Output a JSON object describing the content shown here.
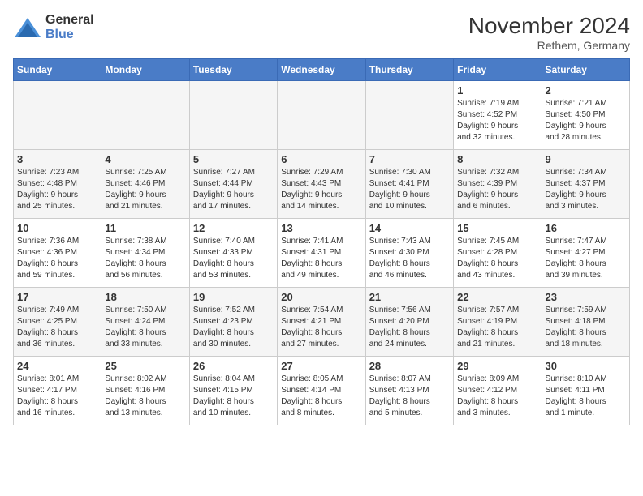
{
  "logo": {
    "general": "General",
    "blue": "Blue"
  },
  "title": {
    "month": "November 2024",
    "location": "Rethem, Germany"
  },
  "weekdays": [
    "Sunday",
    "Monday",
    "Tuesday",
    "Wednesday",
    "Thursday",
    "Friday",
    "Saturday"
  ],
  "weeks": [
    [
      {
        "day": "",
        "info": ""
      },
      {
        "day": "",
        "info": ""
      },
      {
        "day": "",
        "info": ""
      },
      {
        "day": "",
        "info": ""
      },
      {
        "day": "",
        "info": ""
      },
      {
        "day": "1",
        "info": "Sunrise: 7:19 AM\nSunset: 4:52 PM\nDaylight: 9 hours\nand 32 minutes."
      },
      {
        "day": "2",
        "info": "Sunrise: 7:21 AM\nSunset: 4:50 PM\nDaylight: 9 hours\nand 28 minutes."
      }
    ],
    [
      {
        "day": "3",
        "info": "Sunrise: 7:23 AM\nSunset: 4:48 PM\nDaylight: 9 hours\nand 25 minutes."
      },
      {
        "day": "4",
        "info": "Sunrise: 7:25 AM\nSunset: 4:46 PM\nDaylight: 9 hours\nand 21 minutes."
      },
      {
        "day": "5",
        "info": "Sunrise: 7:27 AM\nSunset: 4:44 PM\nDaylight: 9 hours\nand 17 minutes."
      },
      {
        "day": "6",
        "info": "Sunrise: 7:29 AM\nSunset: 4:43 PM\nDaylight: 9 hours\nand 14 minutes."
      },
      {
        "day": "7",
        "info": "Sunrise: 7:30 AM\nSunset: 4:41 PM\nDaylight: 9 hours\nand 10 minutes."
      },
      {
        "day": "8",
        "info": "Sunrise: 7:32 AM\nSunset: 4:39 PM\nDaylight: 9 hours\nand 6 minutes."
      },
      {
        "day": "9",
        "info": "Sunrise: 7:34 AM\nSunset: 4:37 PM\nDaylight: 9 hours\nand 3 minutes."
      }
    ],
    [
      {
        "day": "10",
        "info": "Sunrise: 7:36 AM\nSunset: 4:36 PM\nDaylight: 8 hours\nand 59 minutes."
      },
      {
        "day": "11",
        "info": "Sunrise: 7:38 AM\nSunset: 4:34 PM\nDaylight: 8 hours\nand 56 minutes."
      },
      {
        "day": "12",
        "info": "Sunrise: 7:40 AM\nSunset: 4:33 PM\nDaylight: 8 hours\nand 53 minutes."
      },
      {
        "day": "13",
        "info": "Sunrise: 7:41 AM\nSunset: 4:31 PM\nDaylight: 8 hours\nand 49 minutes."
      },
      {
        "day": "14",
        "info": "Sunrise: 7:43 AM\nSunset: 4:30 PM\nDaylight: 8 hours\nand 46 minutes."
      },
      {
        "day": "15",
        "info": "Sunrise: 7:45 AM\nSunset: 4:28 PM\nDaylight: 8 hours\nand 43 minutes."
      },
      {
        "day": "16",
        "info": "Sunrise: 7:47 AM\nSunset: 4:27 PM\nDaylight: 8 hours\nand 39 minutes."
      }
    ],
    [
      {
        "day": "17",
        "info": "Sunrise: 7:49 AM\nSunset: 4:25 PM\nDaylight: 8 hours\nand 36 minutes."
      },
      {
        "day": "18",
        "info": "Sunrise: 7:50 AM\nSunset: 4:24 PM\nDaylight: 8 hours\nand 33 minutes."
      },
      {
        "day": "19",
        "info": "Sunrise: 7:52 AM\nSunset: 4:23 PM\nDaylight: 8 hours\nand 30 minutes."
      },
      {
        "day": "20",
        "info": "Sunrise: 7:54 AM\nSunset: 4:21 PM\nDaylight: 8 hours\nand 27 minutes."
      },
      {
        "day": "21",
        "info": "Sunrise: 7:56 AM\nSunset: 4:20 PM\nDaylight: 8 hours\nand 24 minutes."
      },
      {
        "day": "22",
        "info": "Sunrise: 7:57 AM\nSunset: 4:19 PM\nDaylight: 8 hours\nand 21 minutes."
      },
      {
        "day": "23",
        "info": "Sunrise: 7:59 AM\nSunset: 4:18 PM\nDaylight: 8 hours\nand 18 minutes."
      }
    ],
    [
      {
        "day": "24",
        "info": "Sunrise: 8:01 AM\nSunset: 4:17 PM\nDaylight: 8 hours\nand 16 minutes."
      },
      {
        "day": "25",
        "info": "Sunrise: 8:02 AM\nSunset: 4:16 PM\nDaylight: 8 hours\nand 13 minutes."
      },
      {
        "day": "26",
        "info": "Sunrise: 8:04 AM\nSunset: 4:15 PM\nDaylight: 8 hours\nand 10 minutes."
      },
      {
        "day": "27",
        "info": "Sunrise: 8:05 AM\nSunset: 4:14 PM\nDaylight: 8 hours\nand 8 minutes."
      },
      {
        "day": "28",
        "info": "Sunrise: 8:07 AM\nSunset: 4:13 PM\nDaylight: 8 hours\nand 5 minutes."
      },
      {
        "day": "29",
        "info": "Sunrise: 8:09 AM\nSunset: 4:12 PM\nDaylight: 8 hours\nand 3 minutes."
      },
      {
        "day": "30",
        "info": "Sunrise: 8:10 AM\nSunset: 4:11 PM\nDaylight: 8 hours\nand 1 minute."
      }
    ]
  ]
}
